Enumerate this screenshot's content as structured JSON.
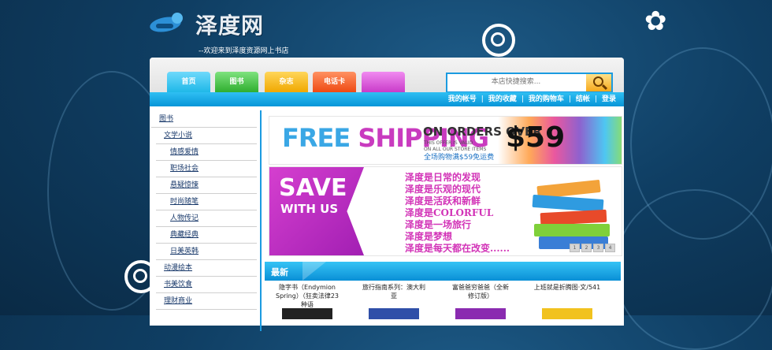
{
  "site": {
    "logo_text": "泽度网",
    "welcome": "--欢迎来到泽度资源网上书店"
  },
  "nav": {
    "tabs": [
      {
        "label": "首页",
        "color": "#1fb8e8"
      },
      {
        "label": "图书",
        "color": "#3cc43c"
      },
      {
        "label": "杂志",
        "color": "#f5b500"
      },
      {
        "label": "电话卡",
        "color": "#f55a22"
      },
      {
        "label": "",
        "color": "#d84fd8"
      }
    ],
    "search_placeholder": "本店快捷搜索...",
    "account_links": [
      "我的帐号",
      "我的收藏",
      "我的购物车",
      "结帐",
      "登录"
    ],
    "separator": "|"
  },
  "sidebar": {
    "items": [
      {
        "label": "图书",
        "level": 0
      },
      {
        "label": "文学小说",
        "level": 1
      },
      {
        "label": "情感爱情",
        "level": 2
      },
      {
        "label": "职场社会",
        "level": 2
      },
      {
        "label": "悬疑惊悚",
        "level": 2
      },
      {
        "label": "时尚随笔",
        "level": 2
      },
      {
        "label": "人物传记",
        "level": 2
      },
      {
        "label": "典藏经典",
        "level": 2
      },
      {
        "label": "日美英韩",
        "level": 2
      },
      {
        "label": "动漫绘本",
        "level": 1
      },
      {
        "label": "书美饮食",
        "level": 1
      },
      {
        "label": "理财商业",
        "level": 1
      }
    ]
  },
  "banner_shipping": {
    "headline_a": "FREE ",
    "headline_b": "SHIPPING",
    "on_orders": "ON ORDERS OVER",
    "fine_print_1": "THIS OFFER IS VALID",
    "fine_print_2": "ON ALL OUR STORE ITEMS",
    "price": "$59",
    "cn_note": "全场购物满$59免运费"
  },
  "banner_save": {
    "save": "SAVE",
    "with_us": "WITH US",
    "slogans": [
      "泽度是日常的发现",
      "泽度是乐观的现代",
      "泽度是活跃和新鲜",
      "泽度是COLORFUL",
      "泽度是一场旅行",
      "泽度是梦想",
      "泽度是每天都在改变......"
    ],
    "pages": [
      "1",
      "2",
      "3",
      "4"
    ]
  },
  "latest": {
    "title": "最新",
    "products": [
      {
        "title": "隐字书（Endymion Spring）（狂卖法律23种语"
      },
      {
        "title": "旅行指南系列：澳大利亚"
      },
      {
        "title": "富爸爸穷爸爸（全新修订版）"
      },
      {
        "title": "上班就是折腾图·文/541"
      }
    ]
  },
  "colors": {
    "accent": "#1b9be0",
    "slogan": "#d233b7",
    "background": "#0f3e63"
  }
}
